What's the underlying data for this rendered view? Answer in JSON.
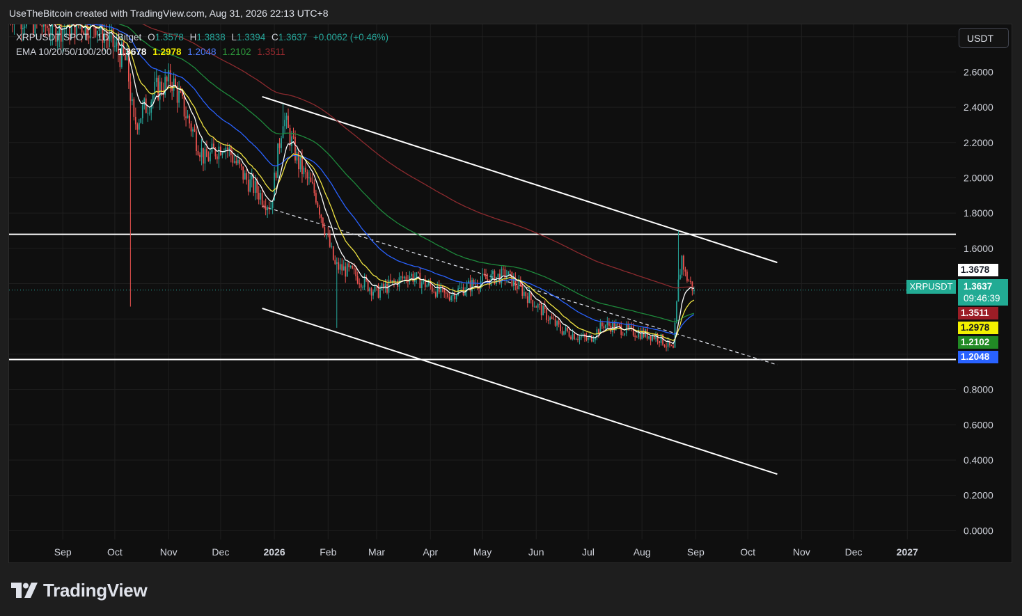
{
  "header": {
    "author": "UseTheBitcoin created with TradingView.com, Aug 31, 2026 22:13 UTC+8"
  },
  "legend": {
    "symbol": "XRPUSDT SPOT · 1D · Bitget",
    "o_label": "O",
    "o": "1.3578",
    "h_label": "H",
    "h": "1.3838",
    "l_label": "L",
    "l": "1.3394",
    "c_label": "C",
    "c": "1.3637",
    "change": "+0.0062 (+0.46%)",
    "ema_label": "EMA 10/20/50/100/200",
    "ema": [
      "1.3678",
      "1.2978",
      "1.2048",
      "1.2102",
      "1.3511"
    ]
  },
  "currency_button": "USDT",
  "symbol_tag": "XRPUSDT",
  "last_price": "1.3637",
  "countdown": "09:46:39",
  "ema_tags": [
    {
      "value": "1.3678",
      "price": 1.3678,
      "bg": "#ffffff",
      "fg": "#131722"
    },
    {
      "value": "1.3511",
      "price": 1.3511,
      "bg": "#9c1d26",
      "fg": "#ffffff"
    },
    {
      "value": "1.2978",
      "price": 1.2978,
      "bg": "#f3f000",
      "fg": "#131722"
    },
    {
      "value": "1.2102",
      "price": 1.2102,
      "bg": "#218a25",
      "fg": "#ffffff"
    },
    {
      "value": "1.2048",
      "price": 1.2048,
      "bg": "#2962ff",
      "fg": "#ffffff"
    }
  ],
  "colors": {
    "ema10": "#ffffff",
    "ema20": "#f0e442",
    "ema50": "#2962ff",
    "ema100": "#1e8a3c",
    "ema200": "#8c2a2e",
    "up": "#26a69a",
    "down": "#ef5350"
  },
  "logo": {
    "text": "TradingView",
    "icon": "tradingview-logo-icon"
  },
  "chart_data": {
    "type": "candlestick",
    "y_axis": {
      "ticks": [
        2.6,
        2.4,
        2.2,
        2.0,
        1.8,
        1.6,
        0.8,
        0.6,
        0.4,
        0.2,
        0.0
      ],
      "tick_labels": [
        "2.6000",
        "2.4000",
        "2.2000",
        "2.0000",
        "1.8000",
        "1.6000",
        "0.8000",
        "0.6000",
        "0.4000",
        "0.2000",
        "0.0000"
      ],
      "ylim": [
        -0.05,
        2.87
      ]
    },
    "x_axis": {
      "labels": [
        {
          "text": "Sep",
          "date": "2025-09-01",
          "bold": false
        },
        {
          "text": "Oct",
          "date": "2025-10-01",
          "bold": false
        },
        {
          "text": "Nov",
          "date": "2025-11-01",
          "bold": false
        },
        {
          "text": "Dec",
          "date": "2025-12-01",
          "bold": false
        },
        {
          "text": "2026",
          "date": "2026-01-01",
          "bold": true
        },
        {
          "text": "Feb",
          "date": "2026-02-01",
          "bold": false
        },
        {
          "text": "Mar",
          "date": "2026-03-01",
          "bold": false
        },
        {
          "text": "Apr",
          "date": "2026-04-01",
          "bold": false
        },
        {
          "text": "May",
          "date": "2026-05-01",
          "bold": false
        },
        {
          "text": "Jun",
          "date": "2026-06-01",
          "bold": false
        },
        {
          "text": "Jul",
          "date": "2026-07-01",
          "bold": false
        },
        {
          "text": "Aug",
          "date": "2026-08-01",
          "bold": false
        },
        {
          "text": "Sep",
          "date": "2026-09-01",
          "bold": false
        },
        {
          "text": "Oct",
          "date": "2026-10-01",
          "bold": false
        },
        {
          "text": "Nov",
          "date": "2026-11-01",
          "bold": false
        },
        {
          "text": "Dec",
          "date": "2026-12-01",
          "bold": false
        },
        {
          "text": "2027",
          "date": "2027-01-01",
          "bold": true
        }
      ],
      "xlim": [
        "2025-08-01",
        "2027-01-29"
      ]
    },
    "price_anchors": [
      {
        "date": "2025-08-01",
        "close": 2.95
      },
      {
        "date": "2025-08-25",
        "close": 2.85
      },
      {
        "date": "2025-09-20",
        "close": 2.88
      },
      {
        "date": "2025-10-08",
        "close": 2.65
      },
      {
        "date": "2025-10-12",
        "close": 2.3
      },
      {
        "date": "2025-10-25",
        "close": 2.5
      },
      {
        "date": "2025-11-03",
        "close": 2.55
      },
      {
        "date": "2025-11-22",
        "close": 2.1
      },
      {
        "date": "2025-12-03",
        "close": 2.2
      },
      {
        "date": "2025-12-15",
        "close": 2.0
      },
      {
        "date": "2025-12-30",
        "close": 1.84
      },
      {
        "date": "2026-01-06",
        "close": 2.35
      },
      {
        "date": "2026-01-15",
        "close": 2.08
      },
      {
        "date": "2026-01-25",
        "close": 1.9
      },
      {
        "date": "2026-02-05",
        "close": 1.5
      },
      {
        "date": "2026-02-15",
        "close": 1.46
      },
      {
        "date": "2026-03-01",
        "close": 1.35
      },
      {
        "date": "2026-03-20",
        "close": 1.45
      },
      {
        "date": "2026-04-10",
        "close": 1.33
      },
      {
        "date": "2026-05-01",
        "close": 1.42
      },
      {
        "date": "2026-05-15",
        "close": 1.45
      },
      {
        "date": "2026-06-01",
        "close": 1.28
      },
      {
        "date": "2026-06-15",
        "close": 1.14
      },
      {
        "date": "2026-07-01",
        "close": 1.08
      },
      {
        "date": "2026-07-10",
        "close": 1.17
      },
      {
        "date": "2026-07-25",
        "close": 1.13
      },
      {
        "date": "2026-08-10",
        "close": 1.1
      },
      {
        "date": "2026-08-19",
        "close": 1.02
      },
      {
        "date": "2026-08-22",
        "close": 1.4
      },
      {
        "date": "2026-08-24",
        "close": 1.55
      },
      {
        "date": "2026-08-26",
        "close": 1.45
      },
      {
        "date": "2026-08-31",
        "close": 1.3637
      }
    ],
    "notable_wicks": [
      {
        "date": "2025-10-10",
        "low": 1.27
      },
      {
        "date": "2026-01-06",
        "high": 2.42
      },
      {
        "date": "2026-02-06",
        "low": 1.15
      },
      {
        "date": "2026-08-22",
        "high": 1.7
      }
    ],
    "horizontal_levels": [
      1.68,
      0.97
    ],
    "channel_upper": {
      "start": [
        "2025-12-25",
        2.46
      ],
      "end": [
        "2026-10-18",
        1.52
      ]
    },
    "channel_lower": {
      "start": [
        "2025-12-25",
        1.26
      ],
      "end": [
        "2026-10-18",
        0.32
      ]
    },
    "dashed_trendline": {
      "start": [
        "2025-12-25",
        1.84
      ],
      "end": [
        "2026-10-18",
        0.94
      ]
    },
    "last_price_line": 1.3637
  }
}
